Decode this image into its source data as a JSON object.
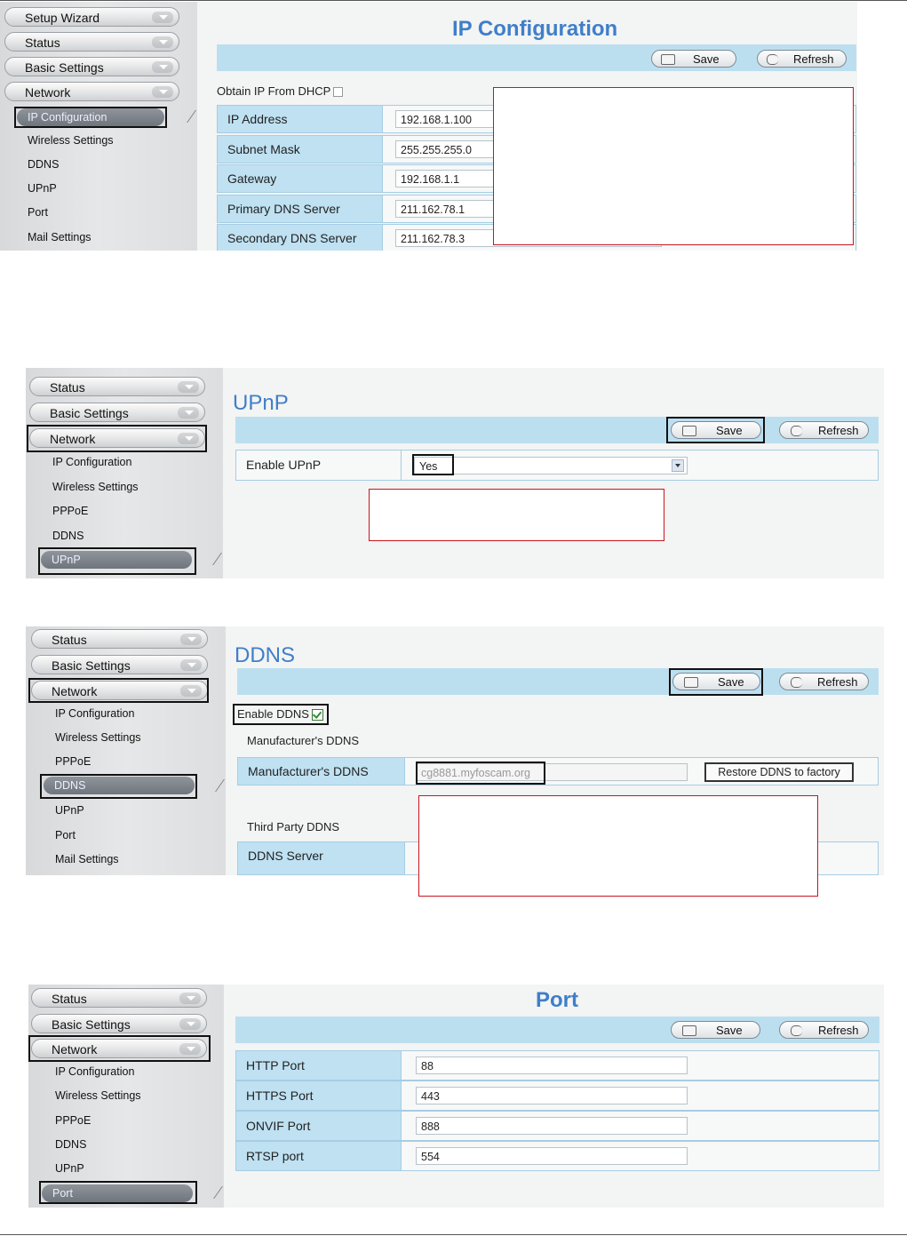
{
  "ip_config": {
    "sidebar": {
      "menus": [
        "Setup Wizard",
        "Status",
        "Basic Settings",
        "Network"
      ],
      "items": [
        "IP Configuration",
        "Wireless Settings",
        "DDNS",
        "UPnP",
        "Port",
        "Mail Settings"
      ]
    },
    "title": "IP Configuration",
    "save": "Save",
    "refresh": "Refresh",
    "dhcp_label": "Obtain IP From DHCP",
    "fields": [
      {
        "label": "IP Address",
        "value": "192.168.1.100"
      },
      {
        "label": "Subnet Mask",
        "value": "255.255.255.0"
      },
      {
        "label": "Gateway",
        "value": "192.168.1.1"
      },
      {
        "label": "Primary DNS Server",
        "value": "211.162.78.1"
      },
      {
        "label": "Secondary DNS Server",
        "value": "211.162.78.3"
      }
    ]
  },
  "upnp": {
    "sidebar": {
      "menus": [
        "Status",
        "Basic Settings",
        "Network"
      ],
      "items": [
        "IP Configuration",
        "Wireless Settings",
        "PPPoE",
        "DDNS",
        "UPnP"
      ]
    },
    "title": "UPnP",
    "save": "Save",
    "refresh": "Refresh",
    "enable_label": "Enable UPnP",
    "enable_value": "Yes"
  },
  "ddns": {
    "sidebar": {
      "menus": [
        "Status",
        "Basic Settings",
        "Network"
      ],
      "items": [
        "IP Configuration",
        "Wireless Settings",
        "PPPoE",
        "DDNS",
        "UPnP",
        "Port",
        "Mail Settings"
      ]
    },
    "title": "DDNS",
    "save": "Save",
    "refresh": "Refresh",
    "enable_label": "Enable DDNS",
    "manufacturer_heading": "Manufacturer's DDNS",
    "manufacturer_label": "Manufacturer's DDNS",
    "manufacturer_value": "cg8881.myfoscam.org",
    "restore_button": "Restore DDNS to factory",
    "third_party_heading": "Third Party DDNS",
    "server_label": "DDNS Server"
  },
  "port": {
    "sidebar": {
      "menus": [
        "Status",
        "Basic Settings",
        "Network"
      ],
      "items": [
        "IP Configuration",
        "Wireless Settings",
        "PPPoE",
        "DDNS",
        "UPnP",
        "Port"
      ]
    },
    "title": "Port",
    "save": "Save",
    "refresh": "Refresh",
    "fields": [
      {
        "label": "HTTP Port",
        "value": "88"
      },
      {
        "label": "HTTPS Port",
        "value": "443"
      },
      {
        "label": "ONVIF Port",
        "value": "888"
      },
      {
        "label": "RTSP port",
        "value": "554"
      }
    ]
  }
}
